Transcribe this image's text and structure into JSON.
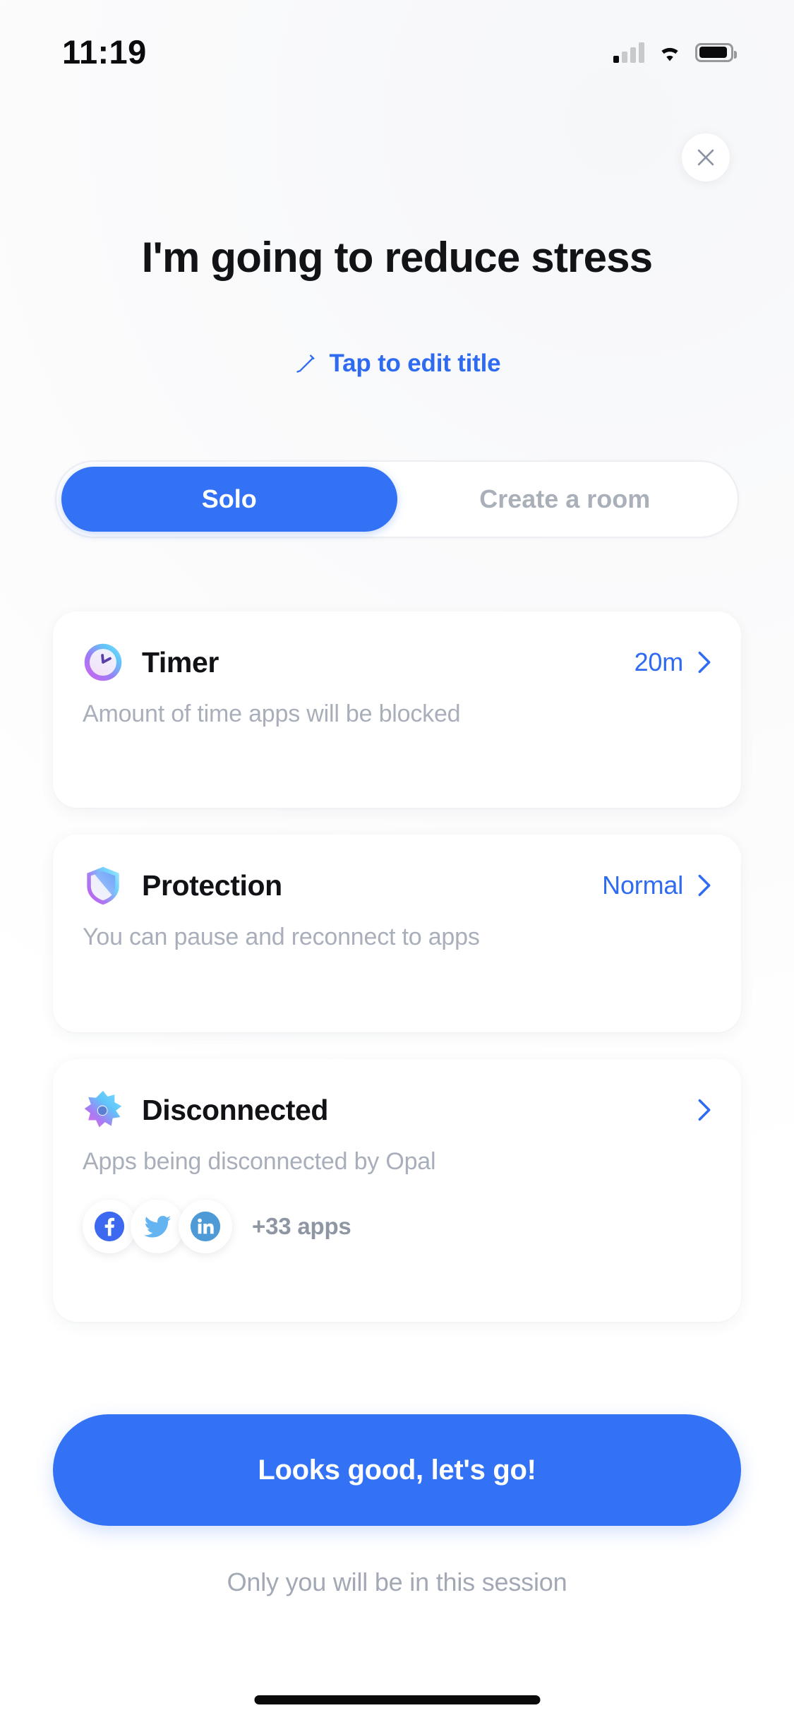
{
  "status_bar": {
    "time": "11:19",
    "icons": [
      "cellular-signal-icon",
      "wifi-icon",
      "battery-icon"
    ],
    "signal_bars_filled": 1,
    "signal_bars_total": 4,
    "battery_level_percent": 92
  },
  "header": {
    "close_icon": "close-icon",
    "title": "I'm going to reduce stress",
    "edit_icon": "pencil-icon",
    "edit_label": "Tap to edit title"
  },
  "mode_switch": {
    "options": [
      {
        "label": "Solo",
        "selected": true
      },
      {
        "label": "Create a room",
        "selected": false
      }
    ]
  },
  "cards": [
    {
      "icon": "clock-icon",
      "title": "Timer",
      "value": "20m",
      "chevron": "chevron-right-icon",
      "subtitle": "Amount of time apps will be blocked"
    },
    {
      "icon": "shield-icon",
      "title": "Protection",
      "value": "Normal",
      "chevron": "chevron-right-icon",
      "subtitle": "You can pause and reconnect to apps"
    },
    {
      "icon": "gear-icon",
      "title": "Disconnected",
      "value": "",
      "chevron": "chevron-right-icon",
      "subtitle": "Apps being disconnected by Opal",
      "apps": [
        {
          "name": "facebook-icon"
        },
        {
          "name": "twitter-icon"
        },
        {
          "name": "linkedin-icon"
        }
      ],
      "apps_more": "+33 apps"
    }
  ],
  "primary_action": {
    "label": "Looks good, let's go!"
  },
  "footnote": "Only you will be in this session",
  "colors": {
    "accent_blue": "#3372f5",
    "link_blue": "#2f6bf0",
    "muted_gray": "#a9afba",
    "title_black": "#101216"
  }
}
